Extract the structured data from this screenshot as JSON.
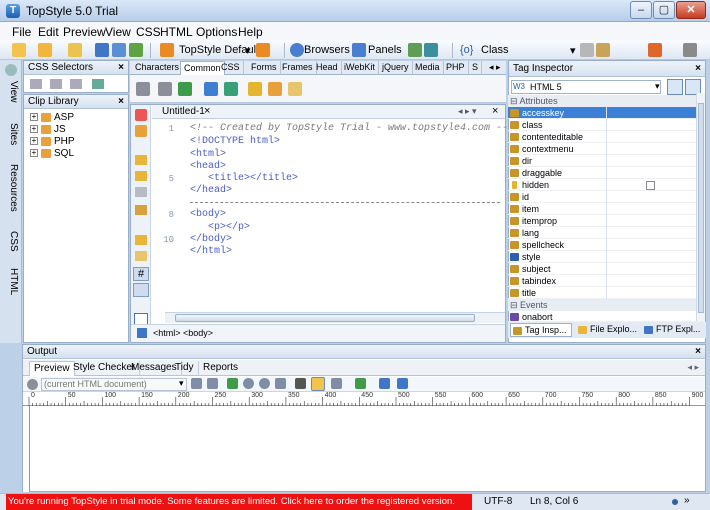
{
  "window": {
    "title": "TopStyle 5.0 Trial"
  },
  "menu": [
    "File",
    "Edit",
    "Preview",
    "View",
    "CSS",
    "HTML",
    "Options",
    "Help"
  ],
  "toolbar": {
    "style_sheet": "TopStyle Default",
    "browsers": "Browsers",
    "panels": "Panels",
    "class_label": "Class"
  },
  "left_tabs": [
    "View",
    "Sites",
    "Resources",
    "CSS",
    "HTML"
  ],
  "css_selectors": {
    "title": "CSS Selectors"
  },
  "clip_library": {
    "title": "Clip Library",
    "items": [
      "ASP",
      "JS",
      "PHP",
      "SQL"
    ]
  },
  "top_tabs": [
    "Characters",
    "Common",
    "CSS",
    "Forms",
    "Frames",
    "Head",
    "iWebKit",
    "jQuery",
    "Media",
    "PHP",
    "S"
  ],
  "active_top_tab": "Common",
  "editor": {
    "doc_tab": "Untitled-1",
    "lines": [
      {
        "n": "1",
        "text": "<!-- Created by TopStyle Trial - www.topstyle4.com -->",
        "comment": true
      },
      {
        "n": "",
        "text": "<!DOCTYPE html>",
        "comment": false
      },
      {
        "n": "",
        "text": "<html>",
        "comment": false
      },
      {
        "n": "",
        "text": "<head>",
        "comment": false
      },
      {
        "n": "5",
        "text": "   <title></title>",
        "comment": false
      },
      {
        "n": "",
        "text": "</head>",
        "comment": false
      },
      {
        "n": "",
        "text": "",
        "comment": false
      },
      {
        "n": "8",
        "text": "<body>",
        "comment": false
      },
      {
        "n": "",
        "text": "   <p></p>",
        "comment": false
      },
      {
        "n": "10",
        "text": "</body>",
        "comment": false
      },
      {
        "n": "",
        "text": "</html>",
        "comment": false
      }
    ],
    "breadcrumb": "<html> <body>"
  },
  "tag_inspector": {
    "title": "Tag Inspector",
    "doctype": "HTML 5",
    "attributes_group": "Attributes",
    "attributes": [
      "accesskey",
      "class",
      "contenteditable",
      "contextmenu",
      "dir",
      "draggable",
      "hidden",
      "id",
      "item",
      "itemprop",
      "lang",
      "spellcheck",
      "style",
      "subject",
      "tabindex",
      "title"
    ],
    "selected": "accesskey",
    "events_group": "Events",
    "events": [
      "onabort"
    ],
    "bottom_tabs": [
      "Tag Insp...",
      "File Explo...",
      "FTP Expl..."
    ]
  },
  "output": {
    "title": "Output",
    "tabs": [
      "Preview",
      "Style Checker",
      "Messages",
      "Tidy",
      "Reports"
    ],
    "source_select": "(current HTML document)",
    "ruler": [
      "0",
      "50",
      "100",
      "150",
      "200",
      "250",
      "300",
      "350",
      "400",
      "450",
      "500",
      "550",
      "600",
      "650",
      "700",
      "750",
      "800",
      "850",
      "900"
    ]
  },
  "status": {
    "trial_message": "You're running TopStyle in trial mode. Some features are limited. Click here to order the registered version.",
    "encoding": "UTF-8",
    "position": "Ln 8, Col 6"
  }
}
